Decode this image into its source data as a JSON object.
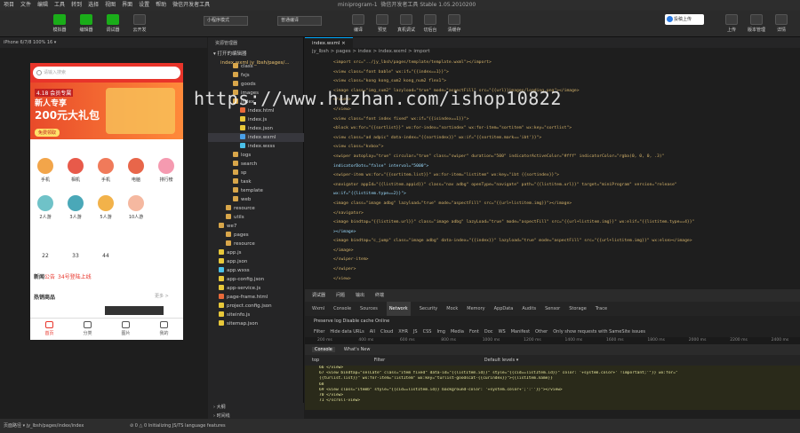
{
  "menu": {
    "items": [
      "项目",
      "文件",
      "编辑",
      "工具",
      "转到",
      "选择",
      "视图",
      "界面",
      "设置",
      "帮助",
      "微信开发者工具"
    ],
    "window_title": "miniprogram-1",
    "subtitle": "微信开发者工具 Stable 1.05.2010200"
  },
  "toolbar": {
    "left_buttons": [
      "模拟器",
      "编辑器",
      "调试器",
      "云开发"
    ],
    "mode_select": "小程序模式",
    "compile_select": "普通编译",
    "mid_buttons": [
      "编译",
      "预览",
      "真机调试",
      "切后台",
      "清缓存"
    ],
    "upload_label": "投稿上传",
    "right_buttons": [
      "上传",
      "版本管理",
      "详情"
    ]
  },
  "simulator": {
    "device": "iPhone 6/7/8 100% 16 ▾",
    "search_placeholder": "请输入搜索",
    "banner": {
      "tag": "4.18 会员专属",
      "line1": "新人专享",
      "line2": "200元大礼包",
      "button": "免费领取"
    },
    "grid_row1": [
      "手机",
      "相机",
      "手机",
      "电脑",
      "排行榜"
    ],
    "grid_row2": [
      "2人游",
      "3人游",
      "5人游",
      "10人游"
    ],
    "numbers": [
      "22",
      "33",
      "44"
    ],
    "news_label": "新闻",
    "news_tag": "公告",
    "news_text": "34号登陆上线",
    "hot_title": "热销商品",
    "more": "更多 >",
    "tabs": [
      "首页",
      "分类",
      "图片",
      "我的"
    ]
  },
  "explorer": {
    "header": "资源管理器",
    "section": "打开的编辑器",
    "open_file": "index.wxml jy_lbsh/pages/...",
    "items": [
      {
        "label": "class",
        "indent": 2,
        "kind": "folder"
      },
      {
        "label": "fxjs",
        "indent": 2,
        "kind": "folder"
      },
      {
        "label": "goods",
        "indent": 2,
        "kind": "folder"
      },
      {
        "label": "images",
        "indent": 2,
        "kind": "folder"
      },
      {
        "label": "index",
        "indent": 2,
        "kind": "folder"
      },
      {
        "label": "index.html",
        "indent": 3,
        "kind": "file"
      },
      {
        "label": "index.js",
        "indent": 3,
        "kind": "file"
      },
      {
        "label": "index.json",
        "indent": 3,
        "kind": "file"
      },
      {
        "label": "index.wxml",
        "indent": 3,
        "kind": "file-active"
      },
      {
        "label": "index.wxss",
        "indent": 3,
        "kind": "file"
      },
      {
        "label": "logs",
        "indent": 2,
        "kind": "folder"
      },
      {
        "label": "search",
        "indent": 2,
        "kind": "folder"
      },
      {
        "label": "sp",
        "indent": 2,
        "kind": "folder"
      },
      {
        "label": "task",
        "indent": 2,
        "kind": "folder"
      },
      {
        "label": "template",
        "indent": 2,
        "kind": "folder"
      },
      {
        "label": "web",
        "indent": 2,
        "kind": "folder"
      },
      {
        "label": "resource",
        "indent": 1,
        "kind": "folder"
      },
      {
        "label": "utils",
        "indent": 1,
        "kind": "folder"
      },
      {
        "label": "we7",
        "indent": 0,
        "kind": "folder"
      },
      {
        "label": "pages",
        "indent": 1,
        "kind": "folder"
      },
      {
        "label": "resource",
        "indent": 1,
        "kind": "folder"
      },
      {
        "label": "app.js",
        "indent": 0,
        "kind": "file"
      },
      {
        "label": "app.json",
        "indent": 0,
        "kind": "file"
      },
      {
        "label": "app.wxss",
        "indent": 0,
        "kind": "file"
      },
      {
        "label": "app-config.json",
        "indent": 0,
        "kind": "file"
      },
      {
        "label": "app-service.js",
        "indent": 0,
        "kind": "file"
      },
      {
        "label": "page-frame.html",
        "indent": 0,
        "kind": "file"
      },
      {
        "label": "project.config.json",
        "indent": 0,
        "kind": "file"
      },
      {
        "label": "siteinfo.js",
        "indent": 0,
        "kind": "file"
      },
      {
        "label": "sitemap.json",
        "indent": 0,
        "kind": "file"
      }
    ],
    "outline": "大纲",
    "timeline": "时间线"
  },
  "editor": {
    "tab": "index.wxml ×",
    "breadcrumb": "jy_lbsh > pages > index > index.wxml > import",
    "lines": [
      {
        "n": "",
        "t": "<import src=\"../jy_lbsh/pages/template/template.wxml\"></import>"
      },
      {
        "n": "",
        "t": "<view class=\"font bable\" wx:if=\"{{index==1}}\">"
      },
      {
        "n": "",
        "t": "  <view class=\"kong kong_sum2 kong_num2 flex1\">"
      },
      {
        "n": "",
        "t": "    <image class=\"img_sum2\" lazyload=\"true\" mode=\"aspectFill\" src=\"{{url}}images/loading.png\"></image>"
      },
      {
        "n": "",
        "t": "  </view>"
      },
      {
        "n": "",
        "t": "</view>"
      },
      {
        "n": "",
        "t": "<view class=\"font index fixed\" wx:if=\"{{isindex==1}}\">"
      },
      {
        "n": "",
        "t": "  <block wx:for=\"{{sortlist}}\" wx:for-index=\"sortindex\" wx:for-item=\"sortitem\" wx:key=\"sortlist\">"
      },
      {
        "n": "",
        "t": "    <view class=\"ad adpic\" data-index=\"{{sortindex}}\" wx:if=\"{{sortitem.mark=='ibt'}}\">"
      },
      {
        "n": "",
        "t": "      <view class=\"kvbox\">"
      },
      {
        "n": "",
        "t": "        <swiper autoplay=\"true\" circular=\"true\" class=\"swiper\" duration=\"500\" indicatorActiveColor=\"#fff\" indicatorColor=\"rgba(0, 0, 0, .3)\""
      },
      {
        "n": "",
        "t": "        indicatorDots=\"false\" interval=\"5000\">"
      },
      {
        "n": "",
        "t": "          <swiper-item wx:for=\"{{sortitem.list}}\" wx:for-item=\"listitem\" wx:key=\"ibt {{sortindex}}\">"
      },
      {
        "n": "",
        "t": "            <navigator appId=\"{{listitem.appid}}\" class=\"nav adbg\" openType=\"navigate\" path=\"{{listitem.url}}\" target=\"miniProgram\" version=\"release\""
      },
      {
        "n": "",
        "t": "            wx:if=\"{{listitem.type==2}}\">"
      },
      {
        "n": "",
        "t": "              <image class=\"image adbg\" lazyload=\"true\" mode=\"aspectFill\" src=\"{{url+listitem.img}}\"></image>"
      },
      {
        "n": "",
        "t": "            </navigator>"
      },
      {
        "n": "",
        "t": "            <image bindtap=\"{{listitem.url}}\" class=\"image adbg\" lazyLoad=\"true\" mode=\"aspectFill\" src=\"{{url+listitem.img}}\" wx:elif=\"{{listitem.type==4}}\""
      },
      {
        "n": "",
        "t": "            ></image>"
      },
      {
        "n": "",
        "t": "            <image bindtap=\"c_jump\" class=\"image adbg\" data-index=\"{{index}}\" lazyload=\"true\" mode=\"aspectFill\" src=\"{{url+listitem.img}}\" wx:else></image>"
      },
      {
        "n": "",
        "t": "            </image>"
      },
      {
        "n": "",
        "t": "          </swiper-item>"
      },
      {
        "n": "",
        "t": "        </swiper>"
      },
      {
        "n": "",
        "t": "      </view>"
      }
    ]
  },
  "watermark": "https://www.huzhan.com/ishop10822",
  "devtools": {
    "tabs": [
      "调试器",
      "问题",
      "输出",
      "终端"
    ],
    "panel_tabs": [
      "Wxml",
      "Console",
      "Sources",
      "Network",
      "Security",
      "Mock",
      "Memory",
      "AppData",
      "Audits",
      "Sensor",
      "Storage",
      "Trace"
    ],
    "active_panel": "Network",
    "controls": "Preserve log   Disable cache   Online",
    "filter_label": "Filter",
    "filter_types": [
      "Hide data URLs",
      "All",
      "Cloud",
      "XHR",
      "JS",
      "CSS",
      "Img",
      "Media",
      "Font",
      "Doc",
      "WS",
      "Manifest",
      "Other",
      "Only show requests with SameSite issues"
    ],
    "timeline": [
      "200 ms",
      "400 ms",
      "600 ms",
      "800 ms",
      "1000 ms",
      "1200 ms",
      "1400 ms",
      "1600 ms",
      "1800 ms",
      "2000 ms",
      "2200 ms",
      "2400 ms"
    ],
    "console_tabs": [
      "Console",
      "What's New"
    ],
    "console_filter": "top",
    "console_levels": "Default levels ▾",
    "console_lines": [
      "66          </view>",
      "67        <view bindtap=\"selCate\" class=\"item fixed\" data-id=\"{{listItem.id}}\" style=\"{{cid==listItem.id}}\" color: '+system.color+' !important;'\"}} wx:for=\"",
      "{{turlist.list}}\" wx:for-item=\"listItem\" wx:key=\"turlist-goodscat-{{curindex}}\">{{listItem.name}}",
      "68",
      "69          <view class=\"itemb\" style=\"{{cid==listItem.id}} background-color: '+system.color+';':''}}\"></view>",
      "70        </view>",
      "71      </scroll-view>"
    ]
  },
  "status": {
    "left": "页面路径 ▾  jy_lbsh/pages/index/index",
    "mid": "⊘ 0 △ 0   Initializing JS/TS language features"
  }
}
